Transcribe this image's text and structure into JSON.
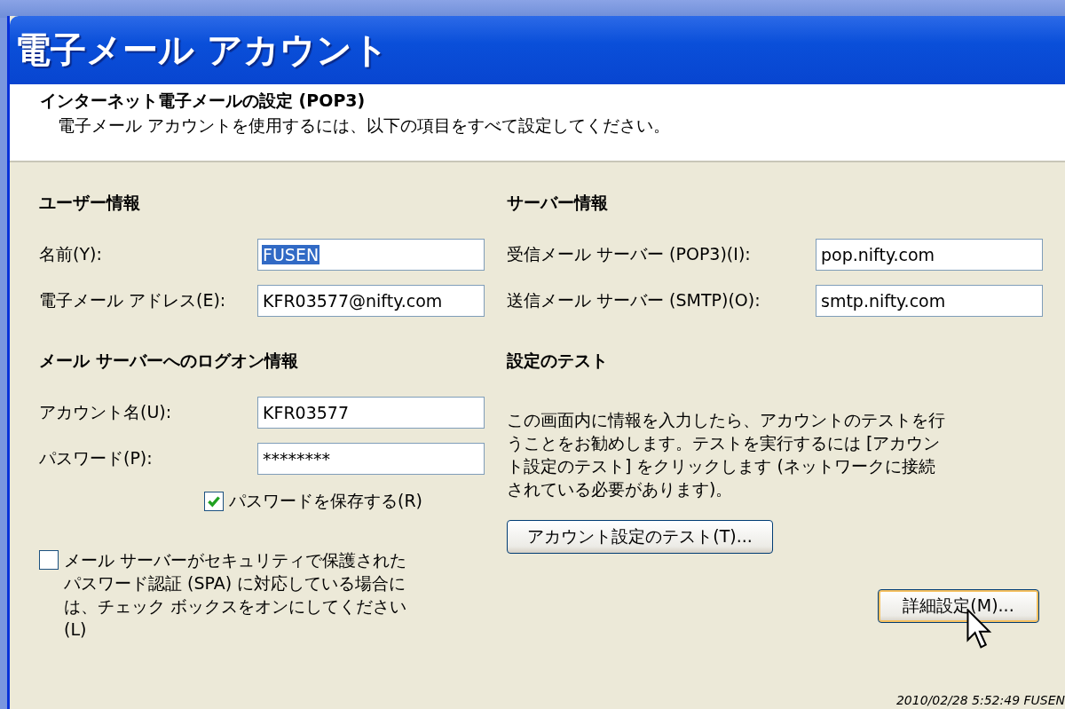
{
  "window": {
    "title": "電子メール アカウント"
  },
  "header": {
    "title": "インターネット電子メールの設定 (POP3)",
    "subtitle": "電子メール アカウントを使用するには、以下の項目をすべて設定してください。"
  },
  "user_info": {
    "heading": "ユーザー情報",
    "fields": [
      {
        "label": "名前(Y):",
        "value": "FUSEN",
        "selected": true
      },
      {
        "label": "電子メール アドレス(E):",
        "value": "KFR03577@nifty.com",
        "selected": false
      }
    ]
  },
  "server_info": {
    "heading": "サーバー情報",
    "fields": [
      {
        "label": "受信メール サーバー (POP3)(I):",
        "value": "pop.nifty.com",
        "selected": false
      },
      {
        "label": "送信メール サーバー (SMTP)(O):",
        "value": "smtp.nifty.com",
        "selected": false
      }
    ]
  },
  "logon_info": {
    "heading": "メール サーバーへのログオン情報",
    "fields": [
      {
        "label": "アカウント名(U):",
        "value": "KFR03577",
        "selected": false
      },
      {
        "label": "パスワード(P):",
        "value": "********",
        "selected": false
      }
    ],
    "save_password": {
      "label": "パスワードを保存する(R)",
      "checked": true
    },
    "spa": {
      "label": "メール サーバーがセキュリティで保護されたパスワード認証 (SPA) に対応している場合には、チェック ボックスをオンにしてください(L)",
      "checked": false
    }
  },
  "test": {
    "heading": "設定のテスト",
    "description": "この画面内に情報を入力したら、アカウントのテストを行うことをお勧めします。テストを実行するには [アカウント設定のテスト] をクリックします (ネットワークに接続されている必要があります)。",
    "button": "アカウント設定のテスト(T)..."
  },
  "more_settings_button": "詳細設定(M)...",
  "capture_stamp": "2010/02/28 5:52:49 FUSEN"
}
